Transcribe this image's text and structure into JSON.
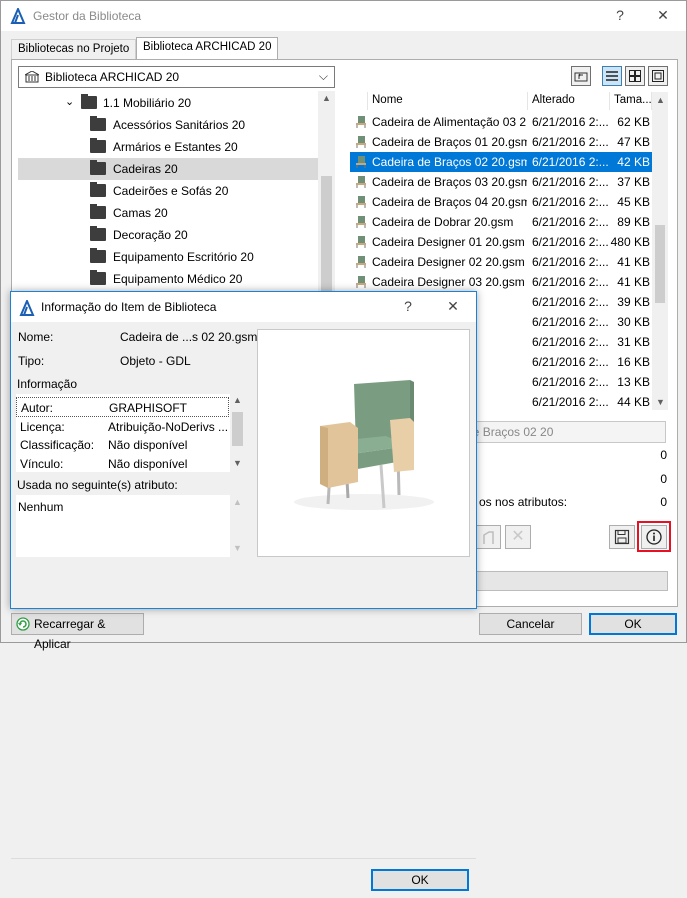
{
  "window": {
    "title": "Gestor da Biblioteca",
    "help": "?",
    "close": "✕"
  },
  "tabs": [
    {
      "label": "Bibliotecas no Projeto"
    },
    {
      "label": "Biblioteca ARCHICAD 20"
    }
  ],
  "library_dropdown": {
    "value": "Biblioteca ARCHICAD 20"
  },
  "tree": {
    "parent": "1.1 Mobiliário 20",
    "items": [
      "Acessórios Sanitários 20",
      "Armários e Estantes 20",
      "Cadeiras 20",
      "Cadeirões e Sofás 20",
      "Camas 20",
      "Decoração 20",
      "Equipamento Escritório 20",
      "Equipamento Médico 20"
    ],
    "selected": "Cadeiras 20"
  },
  "filelist": {
    "headers": {
      "name": "Nome",
      "modified": "Alterado",
      "size": "Tama..."
    },
    "rows": [
      {
        "name": "Cadeira de Alimentação 03 2...",
        "date": "6/21/2016 2:...",
        "size": "62 KB"
      },
      {
        "name": "Cadeira de Braços 01 20.gsm",
        "date": "6/21/2016 2:...",
        "size": "47 KB"
      },
      {
        "name": "Cadeira de Braços 02 20.gsm",
        "date": "6/21/2016 2:...",
        "size": "42 KB",
        "selected": true
      },
      {
        "name": "Cadeira de Braços 03 20.gsm",
        "date": "6/21/2016 2:...",
        "size": "37 KB"
      },
      {
        "name": "Cadeira de Braços 04 20.gsm",
        "date": "6/21/2016 2:...",
        "size": "45 KB"
      },
      {
        "name": "Cadeira de Dobrar 20.gsm",
        "date": "6/21/2016 2:...",
        "size": "89 KB"
      },
      {
        "name": "Cadeira Designer 01 20.gsm",
        "date": "6/21/2016 2:...",
        "size": "480 KB"
      },
      {
        "name": "Cadeira Designer 02 20.gsm",
        "date": "6/21/2016 2:...",
        "size": "41 KB"
      },
      {
        "name": "Cadeira Designer 03 20.gsm",
        "date": "6/21/2016 2:...",
        "size": "41 KB"
      },
      {
        "name": "",
        "date": "6/21/2016 2:...",
        "size": "39 KB"
      },
      {
        "name": "",
        "date": "6/21/2016 2:...",
        "size": "30 KB"
      },
      {
        "name": "",
        "date": "6/21/2016 2:...",
        "size": "31 KB"
      },
      {
        "name": "",
        "date": "6/21/2016 2:...",
        "size": "16 KB"
      },
      {
        "name": "",
        "date": "6/21/2016 2:...",
        "size": "13 KB"
      },
      {
        "name": "",
        "date": "6/21/2016 2:...",
        "size": "44 KB"
      }
    ]
  },
  "details": {
    "name_field": "a de Braços 02 20",
    "count1": "0",
    "count2": "0",
    "attributes_label": "os nos atributos:",
    "count3": "0"
  },
  "footer": {
    "reload_label": "Recarregar & Aplicar",
    "cancel_label": "Cancelar",
    "ok_label": "OK"
  },
  "dialog": {
    "title": "Informação do Item de Biblioteca",
    "help": "?",
    "close": "✕",
    "name_label": "Nome:",
    "name_value": "Cadeira de ...s 02 20.gsm",
    "type_label": "Tipo:",
    "type_value": "Objeto - GDL",
    "info_header": "Informação",
    "info_rows": [
      {
        "key": "Autor:",
        "value": "GRAPHISOFT"
      },
      {
        "key": "Licença:",
        "value": "Atribuição-NoDerivs ..."
      },
      {
        "key": "Classificação:",
        "value": "Não disponível"
      },
      {
        "key": "Vínculo:",
        "value": "Não disponível"
      }
    ],
    "used_in_label": "Usada no seguinte(s) atributo:",
    "used_in_value": "Nenhum",
    "ok_label": "OK"
  },
  "colors": {
    "accent": "#0078d7",
    "highlight_border": "#e81123",
    "chair_green": "#7a9d82",
    "chair_wood": "#e2c49a"
  },
  "icons": [
    "archicad-logo-icon",
    "library-icon",
    "folder-icon",
    "chevron-down-icon",
    "folder-up-icon",
    "list-view-icon",
    "grid-view-icon",
    "preview-view-icon",
    "chair-icon",
    "save-icon",
    "info-icon",
    "reload-icon"
  ]
}
